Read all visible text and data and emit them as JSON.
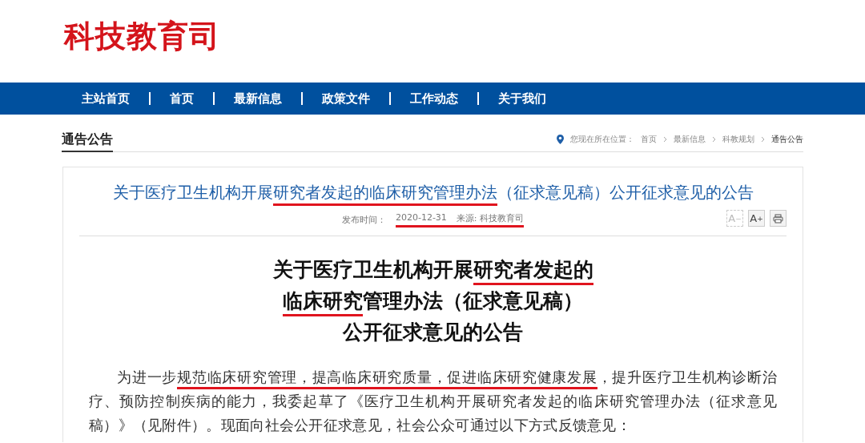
{
  "site_title": "科技教育司",
  "nav": [
    {
      "label": "主站首页"
    },
    {
      "label": "首页"
    },
    {
      "label": "最新信息"
    },
    {
      "label": "政策文件"
    },
    {
      "label": "工作动态"
    },
    {
      "label": "关于我们"
    }
  ],
  "section_title": "通告公告",
  "breadcrumb": {
    "prefix": "您现在所在位置：",
    "items": [
      "首页",
      "最新信息",
      "科教规划",
      "通告公告"
    ]
  },
  "article": {
    "title": [
      {
        "text": "关于医疗卫生机构开展",
        "underlined": false
      },
      {
        "text": "研究者发起的临床研究管理办法",
        "underlined": true
      },
      {
        "text": "（征求意见稿）公开征求意见的公告",
        "underlined": false
      }
    ],
    "meta": {
      "label": "发布时间：",
      "date": "2020-12-31",
      "source": "来源: 科技教育司",
      "underlined": true
    },
    "tools": [
      {
        "label": "A",
        "sup": "−",
        "disabled": true
      },
      {
        "label": "A",
        "sup": "+",
        "disabled": false
      },
      {
        "kind": "print",
        "disabled": false
      }
    ],
    "heading": [
      [
        {
          "text": "关于医疗卫生机构开展",
          "underlined": false
        },
        {
          "text": "研究者发起的",
          "underlined": true
        }
      ],
      [
        {
          "text": "临床研究",
          "underlined": true
        },
        {
          "text": "管理办法（征求意见稿）",
          "underlined": false
        }
      ],
      [
        {
          "text": "公开征求意见的公告",
          "underlined": false
        }
      ]
    ],
    "paragraph": [
      {
        "text": "为进一步",
        "underlined": false
      },
      {
        "text": "规范临床研究管理，提高临床研究质量，促进临床研究健康发展",
        "underlined": true
      },
      {
        "text": "，提升医疗卫生机构诊断治疗、预防控制疾病的能力，我委起草了《医疗卫生机构开展研究者发起的临床研究管理办法（征求意见稿）》（见附件）。现面向社会公开征求意见，社会公众可通过以下方式反馈意见：",
        "underlined": false
      }
    ]
  }
}
